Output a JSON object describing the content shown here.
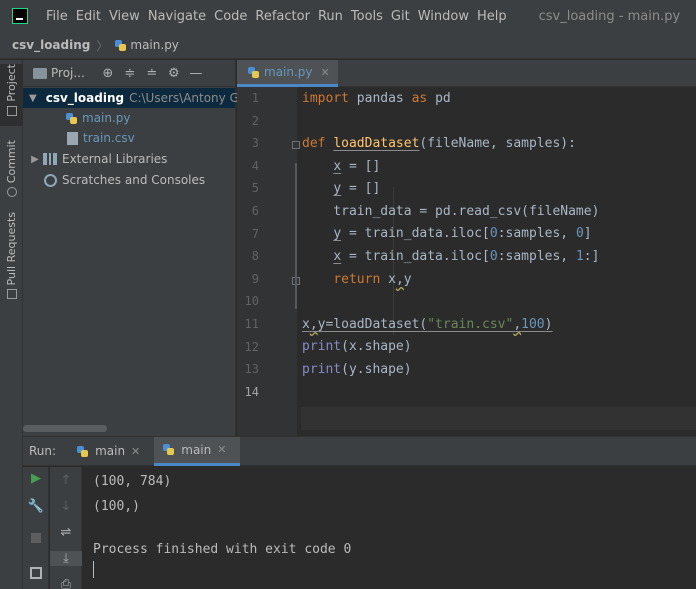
{
  "menubar": {
    "items": [
      "File",
      "Edit",
      "View",
      "Navigate",
      "Code",
      "Refactor",
      "Run",
      "Tools",
      "Git",
      "Window",
      "Help"
    ],
    "title": "csv_loading - main.py"
  },
  "breadcrumb": {
    "project": "csv_loading",
    "file": "main.py"
  },
  "left_strip": {
    "project": "Project",
    "commit": "Commit",
    "pull_requests": "Pull Requests"
  },
  "project_panel": {
    "title": "Proj...",
    "root_name": "csv_loading",
    "root_path": "C:\\Users\\Antony G",
    "files": [
      "main.py",
      "train.csv"
    ],
    "external_libraries": "External Libraries",
    "scratches": "Scratches and Consoles"
  },
  "editor": {
    "tab": "main.py",
    "line_numbers": [
      "1",
      "2",
      "3",
      "4",
      "5",
      "6",
      "7",
      "8",
      "9",
      "10",
      "11",
      "12",
      "13",
      "14"
    ]
  },
  "run": {
    "label": "Run:",
    "tabs": [
      "main",
      "main"
    ],
    "output": [
      "(100, 784)",
      "(100,)",
      "",
      "Process finished with exit code 0"
    ]
  },
  "colors": {
    "accent": "#4a88c7",
    "keyword": "#cc7832",
    "string": "#6a8759",
    "number": "#6897bb",
    "function": "#ffc66d"
  }
}
